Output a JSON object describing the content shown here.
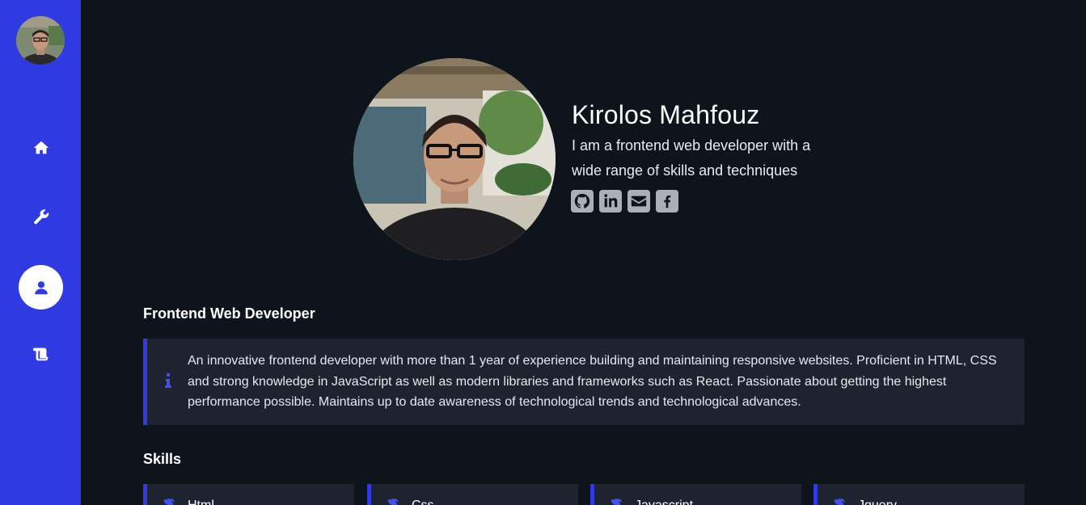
{
  "sidebar": {
    "avatar_alt": "avatar",
    "items": [
      {
        "icon": "home-icon"
      },
      {
        "icon": "wrench-icon"
      },
      {
        "icon": "user-icon",
        "active": true
      },
      {
        "icon": "scroll-icon"
      }
    ]
  },
  "hero": {
    "name": "Kirolos Mahfouz",
    "tagline": "I am a frontend web developer with a wide range of skills and techniques",
    "social": [
      "github-icon",
      "linkedin-icon",
      "envelope-icon",
      "facebook-icon"
    ]
  },
  "about": {
    "title": "Frontend Web Developer",
    "icon": "info-icon",
    "text": "An innovative frontend developer with more than 1 year of experience building and maintaining responsive websites. Proficient in HTML, CSS and strong knowledge in JavaScript as well as modern libraries and frameworks such as React. Passionate about getting the highest performance possible. Maintains up to date awareness of technological trends and technological advances."
  },
  "skills": {
    "title": "Skills",
    "items": [
      {
        "label": "Html",
        "icon": "tools-icon"
      },
      {
        "label": "Css",
        "icon": "tools-icon"
      },
      {
        "label": "Javascript",
        "icon": "tools-icon"
      },
      {
        "label": "Jquery",
        "icon": "tools-icon"
      }
    ]
  },
  "colors": {
    "sidebar": "#2f3ae0",
    "background": "#0e141b",
    "card": "#1d2430",
    "accent": "#4350f0"
  }
}
